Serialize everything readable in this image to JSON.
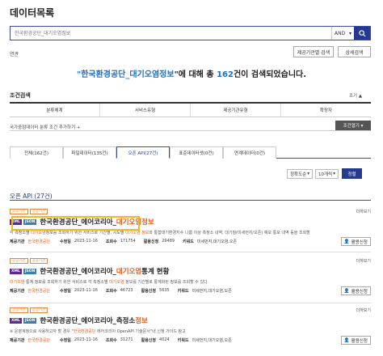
{
  "page": {
    "title": "데이터목록"
  },
  "search": {
    "placeholder": "한국환경공단_대기오염정보",
    "operator": "AND"
  },
  "related": {
    "label": "연관"
  },
  "buttons": {
    "provider_search": "제공기관별 검색",
    "detail_search": "상세검색"
  },
  "summary": {
    "prefix_quote": "\"",
    "keyword": "한국환경공단_대기오염정보",
    "suffix": "\"에 대해 총 ",
    "count": "162",
    "tail": "건이 검색되었습니다."
  },
  "conditions": {
    "title": "조건검색",
    "collapse": "조기 ▲",
    "columns": [
      "분류체계",
      "서비스유형",
      "제공기관유형",
      "확장자"
    ],
    "add_label": "국가중점데이터 분류 조건 추가하기 +",
    "open_label": "조건열기 ▾"
  },
  "tabs": [
    {
      "label": "전체(162건)"
    },
    {
      "label": "파일데이터(135건)"
    },
    {
      "label": "오픈 API(27건)"
    },
    {
      "label": "표준데이터셋(0건)"
    },
    {
      "label": "연계데이터(0건)"
    }
  ],
  "sort": {
    "order": "정확도순",
    "per_page": "10개씩",
    "apply": "정렬"
  },
  "section": {
    "title": "오픈 API (27건)"
  },
  "items": [
    {
      "badges": [
        "공공기관",
        "공공기관"
      ],
      "more": "더하보기",
      "formats": [
        "XML",
        "JSON"
      ],
      "name_plain": "한국환경공단_에어코리아_",
      "name_hl": "대기오염정보",
      "desc_a": "각 측정소별 ",
      "desc_hl1": "대기오염",
      "desc_b": "정보를 조회하기 위한 서비스로 기간별, 시도별 ",
      "desc_hl2": "대기오염 정보",
      "desc_c": "와 통합대기환경지수 나쁨 이상 측정소 내역, 대기질(미세먼지/오존) 예보 통보 내역 등을 조회할",
      "provider_label": "제공기관",
      "provider": "한국환경공단",
      "modified_label": "수정일",
      "modified": "2023-11-16",
      "views_label": "조회수",
      "views": "171754",
      "uses_label": "활용신청",
      "uses": "29489",
      "keywords_label": "키워드",
      "keywords": "미세먼지,대기오염,오존",
      "action": "활용신청"
    },
    {
      "badges": [
        "공공기관",
        "공공기관"
      ],
      "more": "더하보기",
      "formats": [
        "XML",
        "JSON"
      ],
      "name_plain": "한국환경공단_에어코리아_",
      "name_hl": "대기오염",
      "name_tail": "통계 현황",
      "desc_a": "",
      "desc_hl1": "대기오염",
      "desc_b": " 통계 정보를 조회하기 위한 서비스로 각 측정소별 ",
      "desc_hl2": "대기오염",
      "desc_c": " 정보를 기간별로 통계화된 정보를 조회할 수 있다.",
      "provider_label": "제공기관",
      "provider": "한국환경공단",
      "modified_label": "수정일",
      "modified": "2023-11-16",
      "views_label": "조회수",
      "views": "46723",
      "uses_label": "활용신청",
      "uses": "5635",
      "keywords_label": "키워드",
      "keywords": "미세먼지,대기오염,오존",
      "action": "활용신청"
    },
    {
      "badges": [
        "공공기관",
        "공공기관"
      ],
      "more": "더하보기",
      "formats": [
        "XML",
        "JSON"
      ],
      "name_plain": "한국환경공단_에어코리아_측정소",
      "name_hl": "정보",
      "desc_a": "※ 운영계정으로 사용하고자 할 경우 \"",
      "desc_hl1": "한국환경공단",
      "desc_b": " 에어코리아 OpenAPI 기술문서\"내 신청 가이드 참고",
      "desc_hl2": "",
      "desc_c": "",
      "provider_label": "제공기관",
      "provider": "한국환경공단",
      "modified_label": "수정일",
      "modified": "2023-11-16",
      "views_label": "조회수",
      "views": "31271",
      "uses_label": "활용신청",
      "uses": "4024",
      "keywords_label": "키워드",
      "keywords": "미세먼지,대기오염,오존",
      "action": "활용신청"
    }
  ],
  "colors": {
    "accent": "#253a8f",
    "highlight": "#e45c1d",
    "link": "#1d6fc6",
    "focus": "#f3b91f"
  }
}
